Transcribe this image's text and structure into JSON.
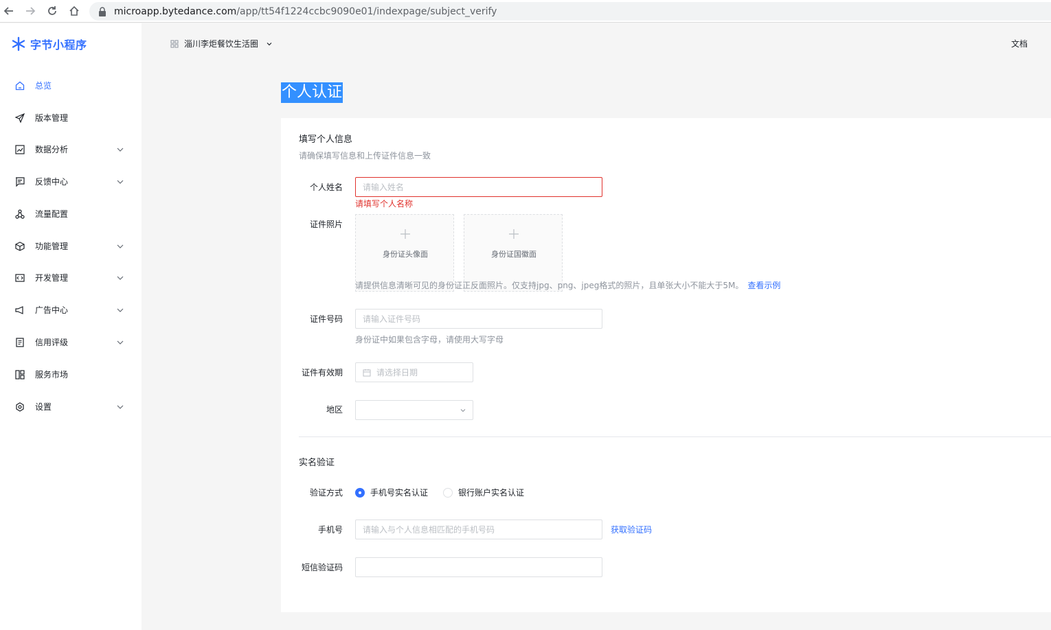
{
  "browser": {
    "url_host": "microapp.bytedance.com",
    "url_path": "/app/tt54f1224ccbc9090e01/indexpage/subject_verify"
  },
  "sidebar": {
    "logo_text": "字节小程序",
    "items": [
      {
        "label": "总览",
        "icon": "home-icon",
        "active": true,
        "expandable": false
      },
      {
        "label": "版本管理",
        "icon": "send-icon",
        "active": false,
        "expandable": false
      },
      {
        "label": "数据分析",
        "icon": "chart-icon",
        "active": false,
        "expandable": true
      },
      {
        "label": "反馈中心",
        "icon": "message-icon",
        "active": false,
        "expandable": true
      },
      {
        "label": "流量配置",
        "icon": "share-icon",
        "active": false,
        "expandable": false
      },
      {
        "label": "功能管理",
        "icon": "cube-icon",
        "active": false,
        "expandable": true
      },
      {
        "label": "开发管理",
        "icon": "code-icon",
        "active": false,
        "expandable": true
      },
      {
        "label": "广告中心",
        "icon": "megaphone-icon",
        "active": false,
        "expandable": true
      },
      {
        "label": "信用评级",
        "icon": "document-icon",
        "active": false,
        "expandable": true
      },
      {
        "label": "服务市场",
        "icon": "layout-icon",
        "active": false,
        "expandable": false
      },
      {
        "label": "设置",
        "icon": "settings-icon",
        "active": false,
        "expandable": true
      }
    ]
  },
  "header": {
    "app_name": "淄川李炬餐饮生活圈",
    "docs_label": "文档"
  },
  "page": {
    "title": "个人认证"
  },
  "form": {
    "section1_title": "填写个人信息",
    "section1_sub": "请确保填写信息和上传证件信息一致",
    "name_label": "个人姓名",
    "name_placeholder": "请输入姓名",
    "name_error": "请填写个人名称",
    "photo_label": "证件照片",
    "photo_front": "身份证头像面",
    "photo_back": "身份证国徽面",
    "photo_hint": "请提供信息清晰可见的身份证正反面照片。仅支持jpg、png、jpeg格式的照片，且单张大小不能大于5M。",
    "photo_example_link": "查看示例",
    "id_label": "证件号码",
    "id_placeholder": "请输入证件号码",
    "id_hint": "身份证中如果包含字母，请使用大写字母",
    "validity_label": "证件有效期",
    "validity_placeholder": "请选择日期",
    "region_label": "地区",
    "region_value": "",
    "section2_title": "实名验证",
    "method_label": "验证方式",
    "method_phone": "手机号实名认证",
    "method_bank": "银行账户实名认证",
    "phone_label": "手机号",
    "phone_placeholder": "请输入与个人信息相匹配的手机号码",
    "get_code_link": "获取验证码",
    "sms_label": "短信验证码",
    "sms_value": ""
  },
  "colors": {
    "accent": "#3370ff",
    "error": "#e0312c",
    "title_highlight": "#3390ff"
  }
}
